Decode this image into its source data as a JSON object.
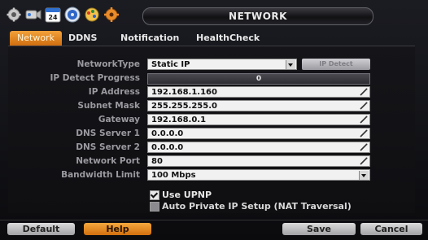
{
  "window": {
    "title": "NETWORK"
  },
  "icons": [
    "gear-icon",
    "camera-icon",
    "calendar-icon",
    "disc-icon",
    "paint-icon",
    "tools-icon"
  ],
  "calendar_number": "24",
  "tabs": [
    {
      "label": "Network",
      "active": true
    },
    {
      "label": "DDNS"
    },
    {
      "label": "Notification"
    },
    {
      "label": "HealthCheck"
    }
  ],
  "form": {
    "network_type": {
      "label": "NetworkType",
      "value": "Static IP"
    },
    "ip_detect_button": "IP Detect",
    "ip_detect_progress": {
      "label": "IP Detect Progress",
      "value": "0"
    },
    "ip_address": {
      "label": "IP Address",
      "value": "192.168.1.160"
    },
    "subnet_mask": {
      "label": "Subnet Mask",
      "value": "255.255.255.0"
    },
    "gateway": {
      "label": "Gateway",
      "value": "192.168.0.1"
    },
    "dns1": {
      "label": "DNS Server 1",
      "value": "0.0.0.0"
    },
    "dns2": {
      "label": "DNS Server 2",
      "value": "0.0.0.0"
    },
    "network_port": {
      "label": "Network Port",
      "value": "80"
    },
    "bandwidth_limit": {
      "label": "Bandwidth Limit",
      "value": "100 Mbps"
    },
    "use_upnp": {
      "label": "Use UPNP",
      "checked": true
    },
    "auto_private_ip": {
      "label": "Auto Private IP Setup (NAT Traversal)",
      "checked": false
    }
  },
  "buttons": {
    "default": "Default",
    "help": "Help",
    "save": "Save",
    "cancel": "Cancel"
  },
  "colors": {
    "accent": "#e0841f",
    "field_bg": "#f1f1f1",
    "panel_bg": "#121216"
  }
}
